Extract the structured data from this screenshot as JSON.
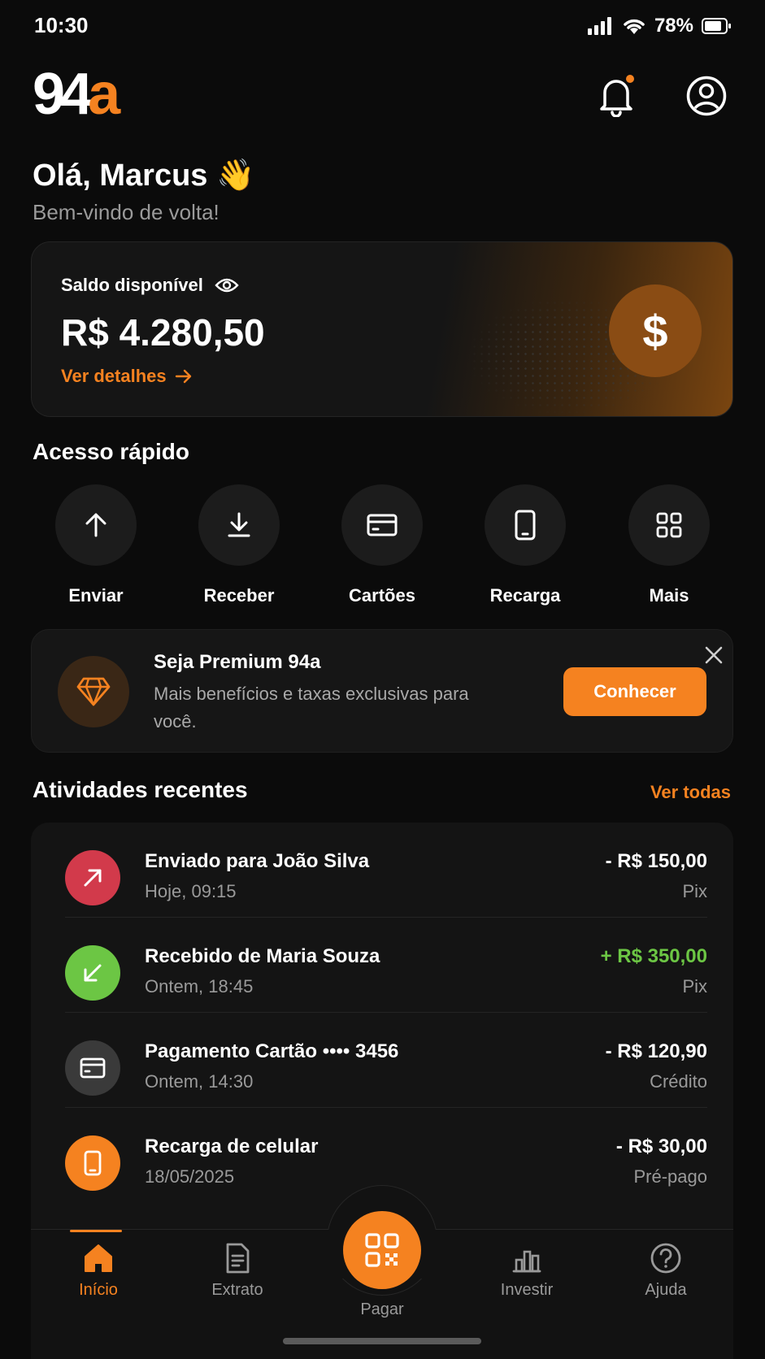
{
  "status_bar": {
    "time": "10:30",
    "battery": "78%"
  },
  "header": {
    "logo_part1": "94",
    "logo_part2": "a"
  },
  "greeting": {
    "title": "Olá, Marcus 👋",
    "subtitle": "Bem-vindo de volta!"
  },
  "balance": {
    "label": "Saldo disponível",
    "amount": "R$ 4.280,50",
    "details_link": "Ver detalhes",
    "currency_symbol": "$"
  },
  "quick_access": {
    "title": "Acesso rápido",
    "items": [
      {
        "label": "Enviar",
        "icon": "arrow-up-icon"
      },
      {
        "label": "Receber",
        "icon": "download-icon"
      },
      {
        "label": "Cartões",
        "icon": "card-icon"
      },
      {
        "label": "Recarga",
        "icon": "phone-icon"
      },
      {
        "label": "Mais",
        "icon": "grid-icon"
      }
    ]
  },
  "premium": {
    "title": "Seja Premium 94a",
    "description": "Mais benefícios e taxas exclusivas para você.",
    "button": "Conhecer"
  },
  "activities": {
    "title": "Atividades recentes",
    "see_all": "Ver todas",
    "items": [
      {
        "title": "Enviado para João Silva",
        "date": "Hoje, 09:15",
        "amount": "- R$ 150,00",
        "type": "Pix",
        "icon": "arrow-up-right-icon",
        "color": "#d23a4b"
      },
      {
        "title": "Recebido de Maria Souza",
        "date": "Ontem, 18:45",
        "amount": "+ R$ 350,00",
        "type": "Pix",
        "icon": "arrow-down-left-icon",
        "color": "#6cc644"
      },
      {
        "title": "Pagamento Cartão •••• 3456",
        "date": "Ontem, 14:30",
        "amount": "- R$ 120,90",
        "type": "Crédito",
        "icon": "card-icon",
        "color": "#3a3a3a"
      },
      {
        "title": "Recarga de celular",
        "date": "18/05/2025",
        "amount": "- R$ 30,00",
        "type": "Pré-pago",
        "icon": "phone-icon",
        "color": "#f58220"
      }
    ]
  },
  "bottom_nav": {
    "items": [
      {
        "label": "Início",
        "icon": "home-icon",
        "active": true
      },
      {
        "label": "Extrato",
        "icon": "statement-icon",
        "active": false
      },
      {
        "label": "Pagar",
        "icon": "qr-code-icon",
        "active": false
      },
      {
        "label": "Investir",
        "icon": "chart-icon",
        "active": false
      },
      {
        "label": "Ajuda",
        "icon": "help-icon",
        "active": false
      }
    ]
  },
  "colors": {
    "accent": "#f58220",
    "positive": "#6cc644",
    "background": "#0b0b0b"
  }
}
